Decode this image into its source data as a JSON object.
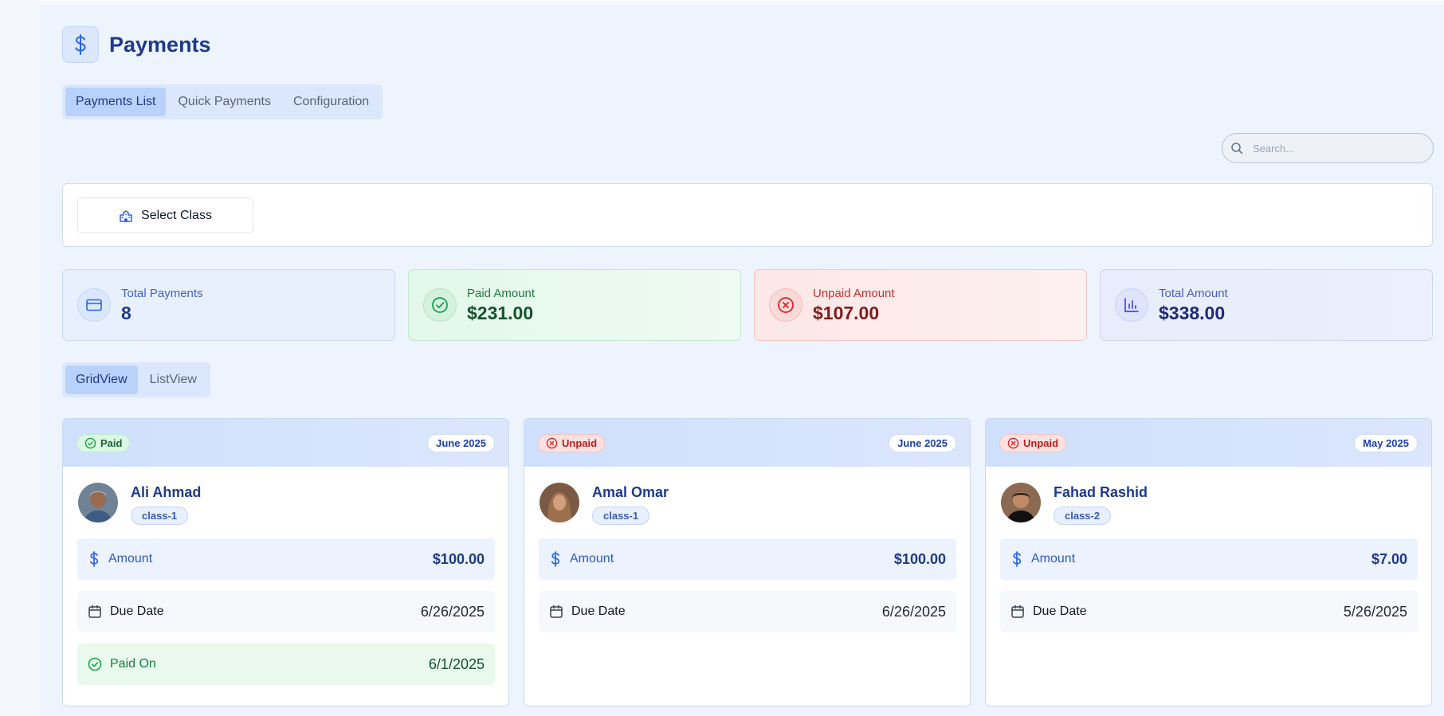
{
  "header": {
    "title": "Payments"
  },
  "tabs": [
    {
      "label": "Payments List",
      "active": true
    },
    {
      "label": "Quick Payments",
      "active": false
    },
    {
      "label": "Configuration",
      "active": false
    }
  ],
  "search": {
    "placeholder": "Search..."
  },
  "filters": {
    "select_class_label": "Select Class"
  },
  "stats": {
    "total_payments": {
      "label": "Total Payments",
      "value": "8"
    },
    "paid_amount": {
      "label": "Paid Amount",
      "value": "$231.00"
    },
    "unpaid_amount": {
      "label": "Unpaid Amount",
      "value": "$107.00"
    },
    "total_amount": {
      "label": "Total Amount",
      "value": "$338.00"
    }
  },
  "view_toggle": [
    {
      "label": "GridView",
      "active": true
    },
    {
      "label": "ListView",
      "active": false
    }
  ],
  "labels": {
    "amount": "Amount",
    "due_date": "Due Date",
    "paid_on": "Paid On"
  },
  "cards": [
    {
      "status": "Paid",
      "month": "June 2025",
      "name": "Ali Ahmad",
      "class": "class-1",
      "amount": "$100.00",
      "due_date": "6/26/2025",
      "paid_on": "6/1/2025"
    },
    {
      "status": "Unpaid",
      "month": "June 2025",
      "name": "Amal Omar",
      "class": "class-1",
      "amount": "$100.00",
      "due_date": "6/26/2025"
    },
    {
      "status": "Unpaid",
      "month": "May 2025",
      "name": "Fahad Rashid",
      "class": "class-2",
      "amount": "$7.00",
      "due_date": "5/26/2025"
    }
  ],
  "colors": {
    "primary": "#1e3a8a",
    "accent": "#2563eb",
    "paid": "#166534",
    "unpaid": "#b91c1c"
  }
}
